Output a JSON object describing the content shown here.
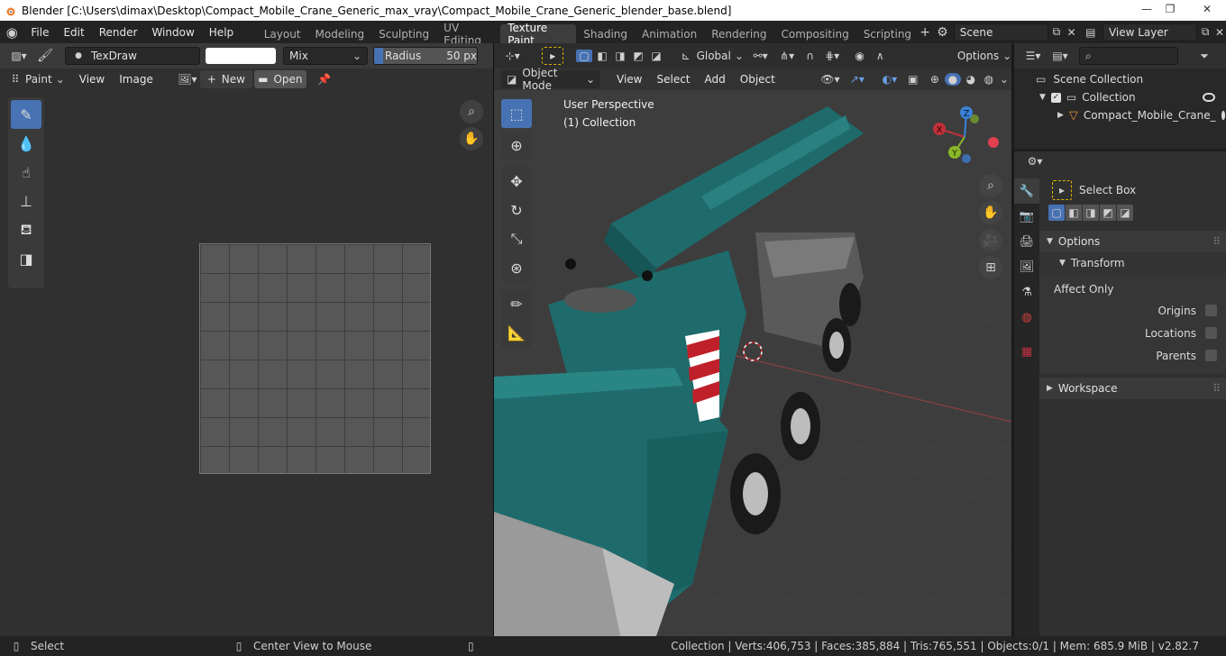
{
  "titlebar": {
    "title": "Blender [C:\\Users\\dimax\\Desktop\\Compact_Mobile_Crane_Generic_max_vray\\Compact_Mobile_Crane_Generic_blender_base.blend]"
  },
  "menubar": {
    "items": [
      "File",
      "Edit",
      "Render",
      "Window",
      "Help"
    ],
    "workspaces": [
      "Layout",
      "Modeling",
      "Sculpting",
      "UV Editing",
      "Texture Paint",
      "Shading",
      "Animation",
      "Rendering",
      "Compositing",
      "Scripting"
    ],
    "active_workspace": "Texture Paint",
    "scene": "Scene",
    "view_layer": "View Layer"
  },
  "image_editor": {
    "brush_name": "TexDraw",
    "blend_mode": "Mix",
    "radius_label": "Radius",
    "radius_value": "50 px",
    "mode": "Paint",
    "menus": [
      "View",
      "Image"
    ],
    "new_label": "New",
    "open_label": "Open",
    "tools": [
      "draw",
      "soften",
      "smear",
      "clone",
      "fill",
      "mask"
    ]
  },
  "viewport": {
    "mode": "Object Mode",
    "menus": [
      "View",
      "Select",
      "Add",
      "Object"
    ],
    "orientation": "Global",
    "options_label": "Options",
    "perspective_label": "User Perspective",
    "collection_label": "(1) Collection",
    "gizmo": {
      "x": "X",
      "y": "Y",
      "z": "Z"
    }
  },
  "outliner": {
    "scene_collection": "Scene Collection",
    "collection": "Collection",
    "object": "Compact_Mobile_Crane_"
  },
  "properties": {
    "tool": "Select Box",
    "options": "Options",
    "transform": "Transform",
    "affect_only": "Affect Only",
    "origins": "Origins",
    "locations": "Locations",
    "parents": "Parents",
    "workspace": "Workspace"
  },
  "statusbar": {
    "select": "Select",
    "center_view": "Center View to Mouse",
    "stats": "Collection | Verts:406,753 | Faces:385,884 | Tris:765,551 | Objects:0/1 | Mem: 685.9 MiB | v2.82.7"
  },
  "colors": {
    "accent": "#4772b3",
    "crane": "#1f6b6b",
    "title_bg": "#ffffff",
    "x_axis": "#c0303a",
    "y_axis": "#8ab828",
    "z_axis": "#3b82d6"
  }
}
